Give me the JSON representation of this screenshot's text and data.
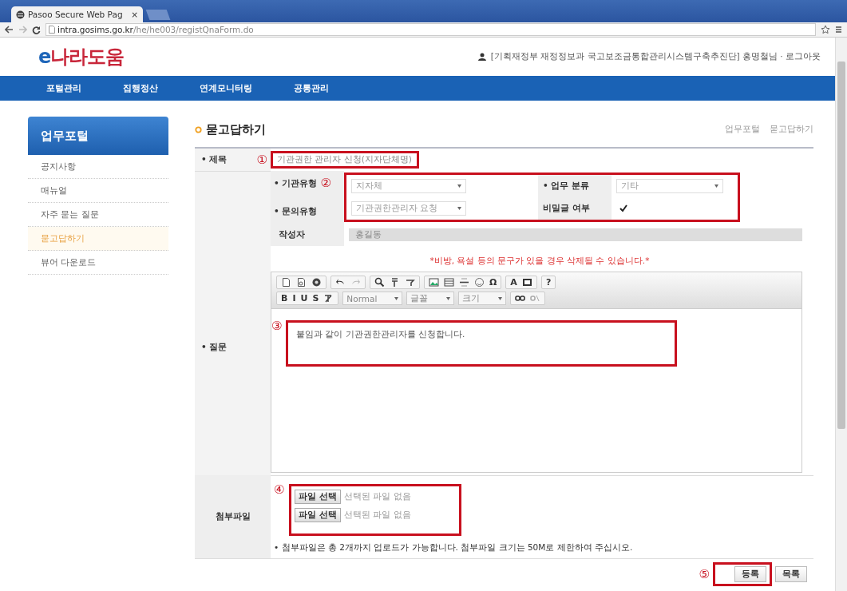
{
  "browser": {
    "tab_title": "Pasoo Secure Web Pag",
    "tab_close": "×",
    "url_host": "intra.gosims.go.kr",
    "url_path": "/he/he003/registQnaForm.do"
  },
  "header": {
    "logo_prefix": "e",
    "logo": "나라도움",
    "user_info": "[기획재정부 재정정보과 국고보조금통합관리시스템구축추진단] 홍명철님 · 로그아웃"
  },
  "nav": [
    {
      "label": "포털관리",
      "selected": false
    },
    {
      "label": "집행정산",
      "selected": false
    },
    {
      "label": "연계모니터링",
      "selected": false
    },
    {
      "label": "공통관리",
      "selected": false
    }
  ],
  "sidebar": {
    "title": "업무포털",
    "items": [
      {
        "label": "공지사항",
        "selected": false
      },
      {
        "label": "매뉴얼",
        "selected": false
      },
      {
        "label": "자주 묻는 질문",
        "selected": false
      },
      {
        "label": "묻고답하기",
        "selected": true
      },
      {
        "label": "뷰어 다운로드",
        "selected": false
      }
    ]
  },
  "page": {
    "title": "묻고답하기",
    "breadcrumb": [
      "업무포털",
      "묻고답하기"
    ]
  },
  "form": {
    "subject": {
      "label": "• 제목",
      "value": "기관권한 관리자 신청(지자단체명)"
    },
    "org_type": {
      "label": "• 기관유형",
      "value": "지자체"
    },
    "category": {
      "label": "• 업무 분류",
      "value": "기타"
    },
    "inquiry_type": {
      "label": "• 문의유형",
      "value": "기관권한관리자 요청"
    },
    "secret": {
      "label": "비밀글 여부",
      "checked": true
    },
    "author": {
      "label": "작성자",
      "value": "홍길동"
    },
    "question_label": "• 질문",
    "notice": "*비방, 욕설 등의 문구가 있을 경우 삭제될 수 있습니다.*",
    "toolbar": [
      [
        [
          {
            "kind": "icon"
          },
          {
            "kind": "icon"
          },
          {
            "kind": "icon"
          }
        ],
        [
          {
            "kind": "icon"
          },
          {
            "kind": "icon"
          }
        ],
        [
          {
            "kind": "icon"
          },
          {
            "kind": "icon"
          },
          {
            "kind": "icon"
          }
        ],
        [
          {
            "kind": "icon"
          },
          {
            "kind": "icon"
          },
          {
            "kind": "icon"
          },
          {
            "kind": "icon"
          },
          {
            "kind": "glyph",
            "text": "Ω"
          }
        ],
        [
          {
            "kind": "glyph",
            "text": "A"
          },
          {
            "kind": "icon"
          }
        ],
        [
          {
            "kind": "glyph",
            "text": "?"
          }
        ]
      ],
      [
        [
          {
            "kind": "glyph",
            "text": "B"
          },
          {
            "kind": "glyph",
            "text": "I"
          },
          {
            "kind": "glyph",
            "text": "U"
          },
          {
            "kind": "glyph",
            "text": "S"
          },
          {
            "kind": "icon"
          }
        ],
        [
          {
            "kind": "dropdown",
            "text": "Normal"
          }
        ],
        [
          {
            "kind": "dropdown",
            "text": "글꼴"
          }
        ],
        [
          {
            "kind": "dropdown",
            "text": "크기"
          }
        ],
        [
          {
            "kind": "icon"
          },
          {
            "kind": "icon"
          }
        ]
      ]
    ],
    "content": "붙임과 같이 기관권한관리자를 신청합니다.",
    "attachments": {
      "label": "첨부파일",
      "files": [
        {
          "button": "파일 선택",
          "status": "선택된 파일 없음"
        },
        {
          "button": "파일 선택",
          "status": "선택된 파일 없음"
        }
      ],
      "note": "• 첨부파일은 총 2개까지 업로드가 가능합니다. 첨부파일 크기는 50M로 제한하여 주십시오."
    },
    "buttons": [
      {
        "label": "등록"
      },
      {
        "label": "목록"
      }
    ]
  },
  "annotations": [
    "①",
    "②",
    "③",
    "④",
    "⑤"
  ]
}
